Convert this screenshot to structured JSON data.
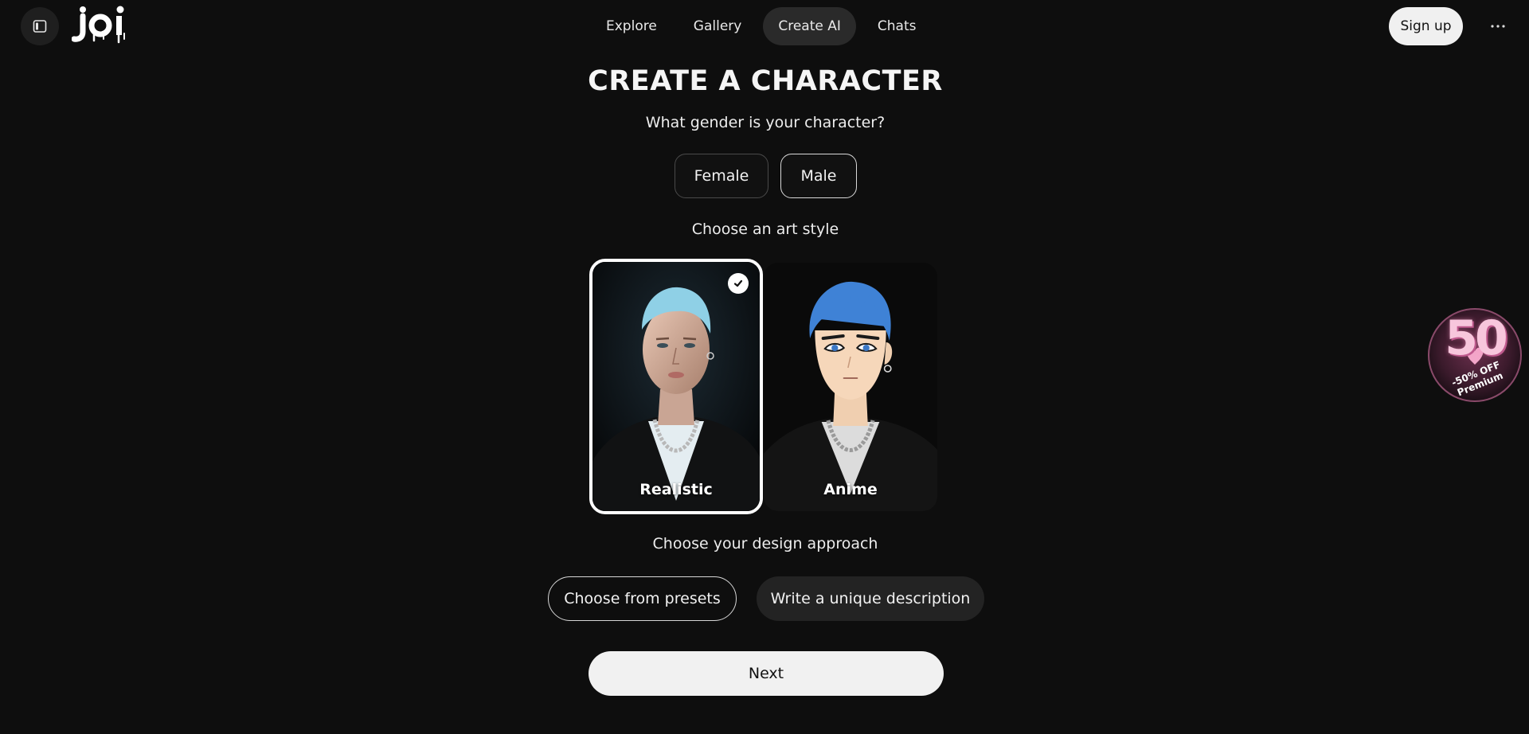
{
  "app": {
    "logo_text": "joi"
  },
  "nav": {
    "items": [
      {
        "label": "Explore",
        "active": false
      },
      {
        "label": "Gallery",
        "active": false
      },
      {
        "label": "Create AI",
        "active": true
      },
      {
        "label": "Chats",
        "active": false
      }
    ]
  },
  "header": {
    "signup_label": "Sign up",
    "more_icon": "more-horizontal-icon",
    "sidebar_icon": "sidebar-toggle-icon"
  },
  "main": {
    "title": "CREATE A CHARACTER",
    "gender_question": "What gender is your character?",
    "gender_options": [
      {
        "label": "Female",
        "selected": false
      },
      {
        "label": "Male",
        "selected": true
      }
    ],
    "art_style_question": "Choose an art style",
    "art_styles": [
      {
        "label": "Realistic",
        "selected": true
      },
      {
        "label": "Anime",
        "selected": false
      }
    ],
    "approach_question": "Choose your design approach",
    "approach_options": [
      {
        "label": "Choose from presets",
        "selected": true
      },
      {
        "label": "Write a unique description",
        "selected": false
      }
    ],
    "next_label": "Next"
  },
  "promo": {
    "number": "50",
    "text": "-50% OFF Premium"
  },
  "colors": {
    "background": "#0e0e0e",
    "accent_light": "#f1f1f1",
    "active_nav": "#2a2a2a",
    "promo_pink": "#f7c6dc"
  }
}
